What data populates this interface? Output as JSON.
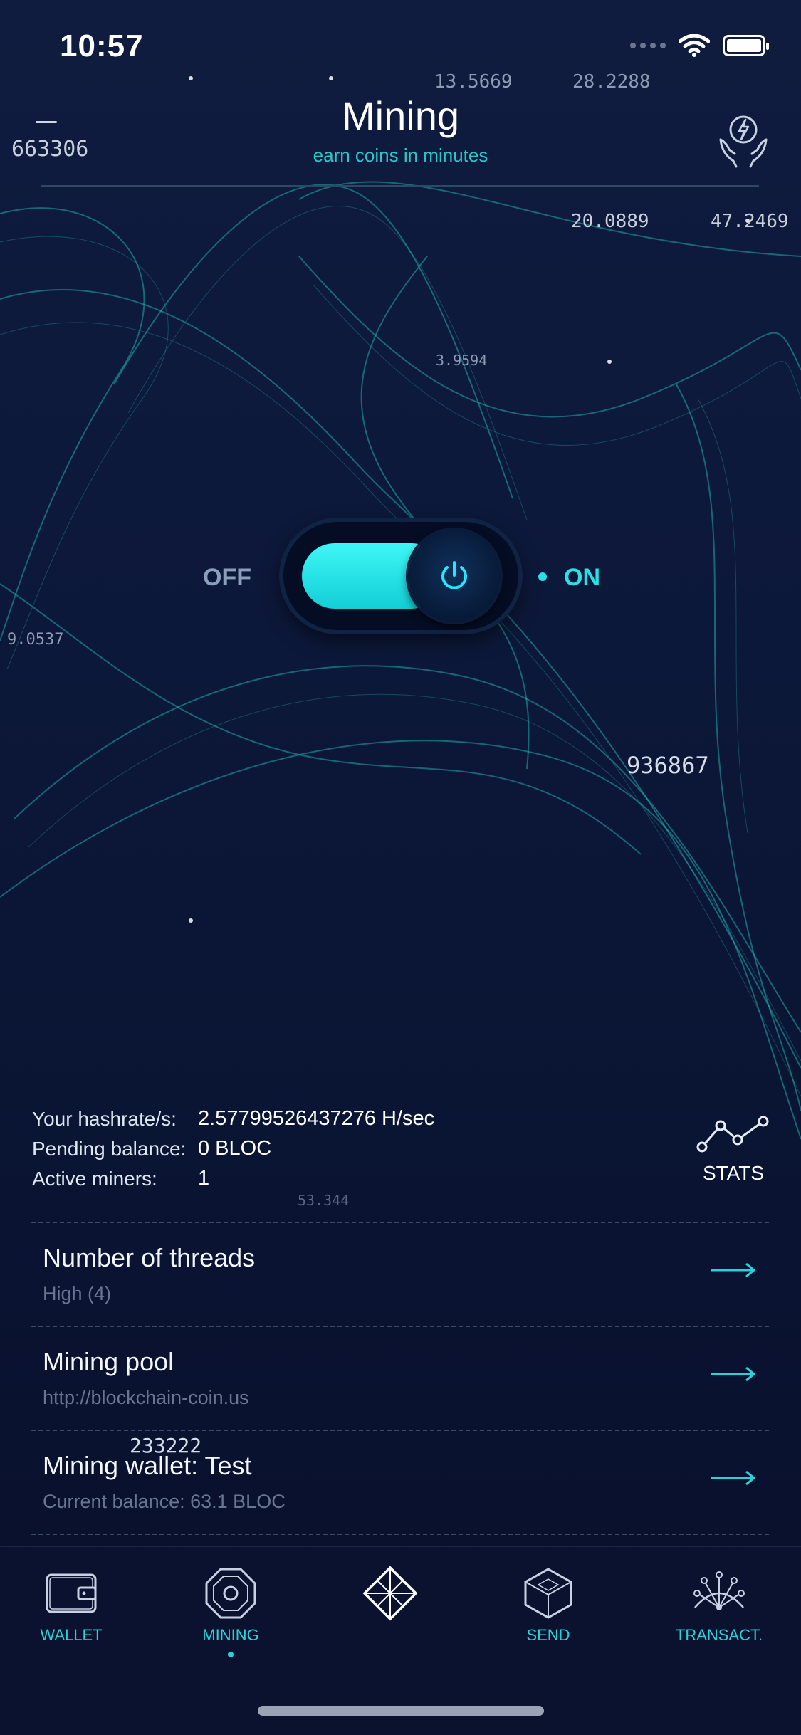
{
  "status_bar": {
    "time": "10:57"
  },
  "header": {
    "title": "Mining",
    "subtitle": "earn coins in minutes"
  },
  "background_numbers": [
    "663306",
    "13.5669",
    "28.2288",
    "20.0889",
    "47.2469",
    "3.9594",
    "936867",
    "9.0537",
    "53.344",
    "233222"
  ],
  "toggle": {
    "off_label": "OFF",
    "on_label": "ON",
    "state": "on"
  },
  "stats": {
    "hashrate_label": "Your hashrate/s:",
    "hashrate_value": "2.57799526437276 H/sec",
    "pending_label": "Pending balance:",
    "pending_value": "0 BLOC",
    "miners_label": "Active miners:",
    "miners_value": "1",
    "button_label": "STATS"
  },
  "settings": [
    {
      "title": "Number of threads",
      "subtitle": "High (4)"
    },
    {
      "title": "Mining pool",
      "subtitle": "http://blockchain-coin.us"
    },
    {
      "title": "Mining wallet: Test",
      "subtitle": "Current balance: 63.1 BLOC"
    }
  ],
  "tabs": [
    {
      "label": "WALLET",
      "icon": "wallet-icon"
    },
    {
      "label": "MINING",
      "icon": "chip-icon",
      "active": true
    },
    {
      "label": "",
      "icon": "diamond-icon"
    },
    {
      "label": "SEND",
      "icon": "cube-icon"
    },
    {
      "label": "TRANSACT.",
      "icon": "network-icon"
    }
  ],
  "colors": {
    "accent": "#27d3d8",
    "background": "#0a1230",
    "mesh": "#23c9c4"
  }
}
